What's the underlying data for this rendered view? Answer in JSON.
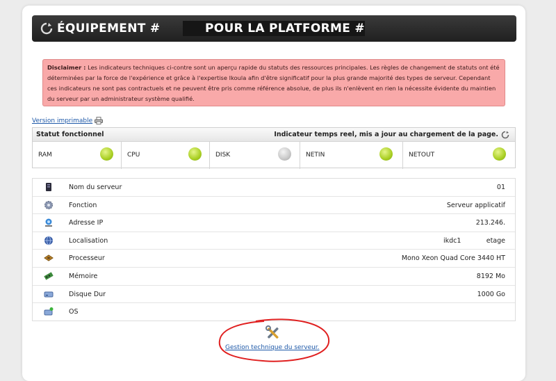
{
  "header": {
    "title_part1": "ÉQUIPEMENT #",
    "title_part2": "POUR LA PLATFORME #"
  },
  "disclaimer": {
    "label": "Disclaimer :",
    "text": " Les indicateurs techniques ci-contre sont un aperçu rapide du statuts des ressources principales. Les règles de changement de statuts ont été déterminées par la force de l'expérience et grâce à l'expertise Ikoula afin d'être significatif pour la plus grande majorité des types de serveur. Cependant ces indicateurs ne sont pas contractuels et ne peuvent être pris comme référence absolue, de plus ils n'enlèvent en rien la nécessite évidente du maintien du serveur par un administrateur système qualifié."
  },
  "print_link": {
    "label": "Version imprimable",
    "icon": "printer-icon"
  },
  "status": {
    "title": "Statut fonctionnel",
    "realtime_note": "Indicateur temps reel, mis a jour au chargement de la page.",
    "indicators": [
      {
        "label": "RAM",
        "state": "ok",
        "color": "#a9cf23"
      },
      {
        "label": "CPU",
        "state": "ok",
        "color": "#a9cf23"
      },
      {
        "label": "DISK",
        "state": "unknown",
        "color": "#c8c8c8"
      },
      {
        "label": "NETIN",
        "state": "ok",
        "color": "#a9cf23"
      },
      {
        "label": "NETOUT",
        "state": "ok",
        "color": "#a9cf23"
      }
    ]
  },
  "server_info": {
    "rows": [
      {
        "key": "Nom du serveur",
        "value": "01",
        "icon": "server-icon"
      },
      {
        "key": "Fonction",
        "value": "Serveur applicatif",
        "icon": "gear-icon"
      },
      {
        "key": "Adresse IP",
        "value": "213.246.",
        "icon": "network-icon"
      },
      {
        "key": "Localisation",
        "value": "ikdc1",
        "value_extra": "etage",
        "icon": "globe-icon"
      },
      {
        "key": "Processeur",
        "value": "Mono Xeon Quad Core 3440 HT",
        "icon": "cpu-icon"
      },
      {
        "key": "Mémoire",
        "value": "8192 Mo",
        "icon": "memory-icon"
      },
      {
        "key": "Disque Dur",
        "value": "1000 Go",
        "icon": "disk-icon"
      },
      {
        "key": "OS",
        "value": "",
        "icon": "os-icon"
      }
    ]
  },
  "footer": {
    "tech_link": "Gestion technique du serveur.",
    "tools_icon": "tools-icon"
  },
  "colors": {
    "highlight_circle": "#e02020",
    "link": "#1d58a8",
    "disclaimer_bg": "#f9a9a9"
  }
}
